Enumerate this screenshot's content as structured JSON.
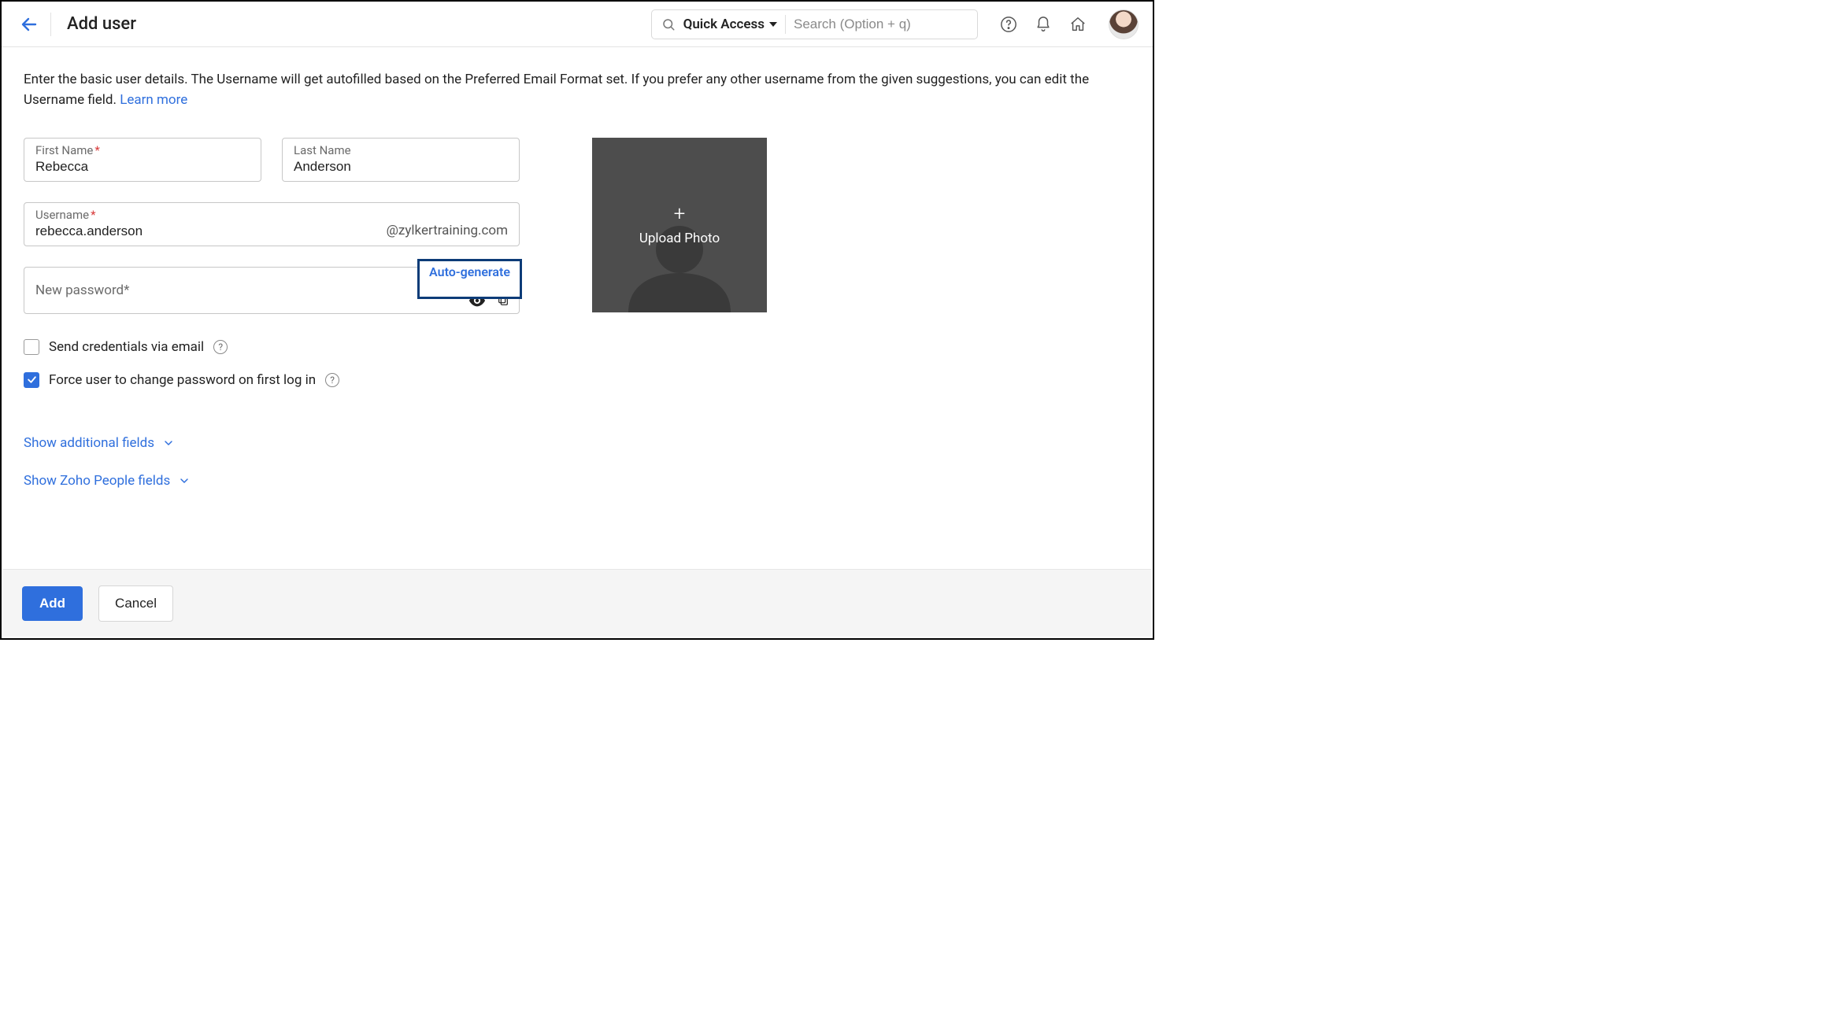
{
  "header": {
    "title": "Add user",
    "quick_access": "Quick Access",
    "search_placeholder": "Search (Option + q)"
  },
  "intro": {
    "text_a": "Enter the basic user details. The Username will get autofilled based on the Preferred Email Format set. If you prefer any other username from the given suggestions, you can edit the Username field.  ",
    "learn_more": "Learn more"
  },
  "fields": {
    "first_name_label": "First Name",
    "first_name_value": "Rebecca",
    "last_name_label": "Last Name",
    "last_name_value": "Anderson",
    "username_label": "Username",
    "username_value": "rebecca.anderson",
    "domain": "@zylkertraining.com",
    "password_label": "New password",
    "auto_generate": "Auto-generate"
  },
  "checks": {
    "send_credentials": "Send credentials via email",
    "send_credentials_checked": false,
    "force_change": "Force user to change password on first log in",
    "force_change_checked": true
  },
  "expanders": {
    "additional": "Show additional fields",
    "zoho_people": "Show Zoho People fields"
  },
  "photo": {
    "upload_label": "Upload Photo"
  },
  "footer": {
    "add": "Add",
    "cancel": "Cancel"
  }
}
